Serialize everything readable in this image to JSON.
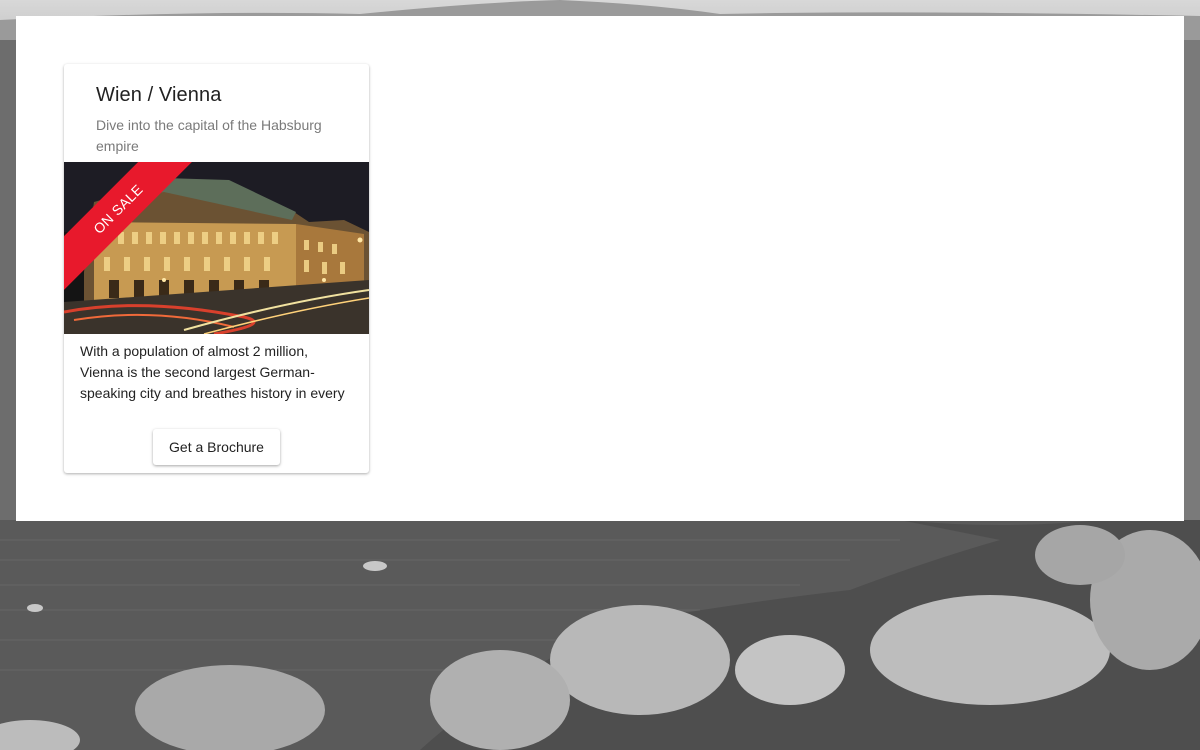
{
  "card": {
    "title": "Wien / Vienna",
    "subtitle": "Dive into the capital of the Habsburg empire",
    "ribbon_label": "ON SALE",
    "body_text": "With a population of almost 2 million, Vienna is the second largest German-speaking city and breathes history in every",
    "button_label": "Get a Brochure"
  },
  "colors": {
    "ribbon": "#e8192c",
    "panel": "#ffffff"
  },
  "background": {
    "description_icon": "landscape-background"
  }
}
